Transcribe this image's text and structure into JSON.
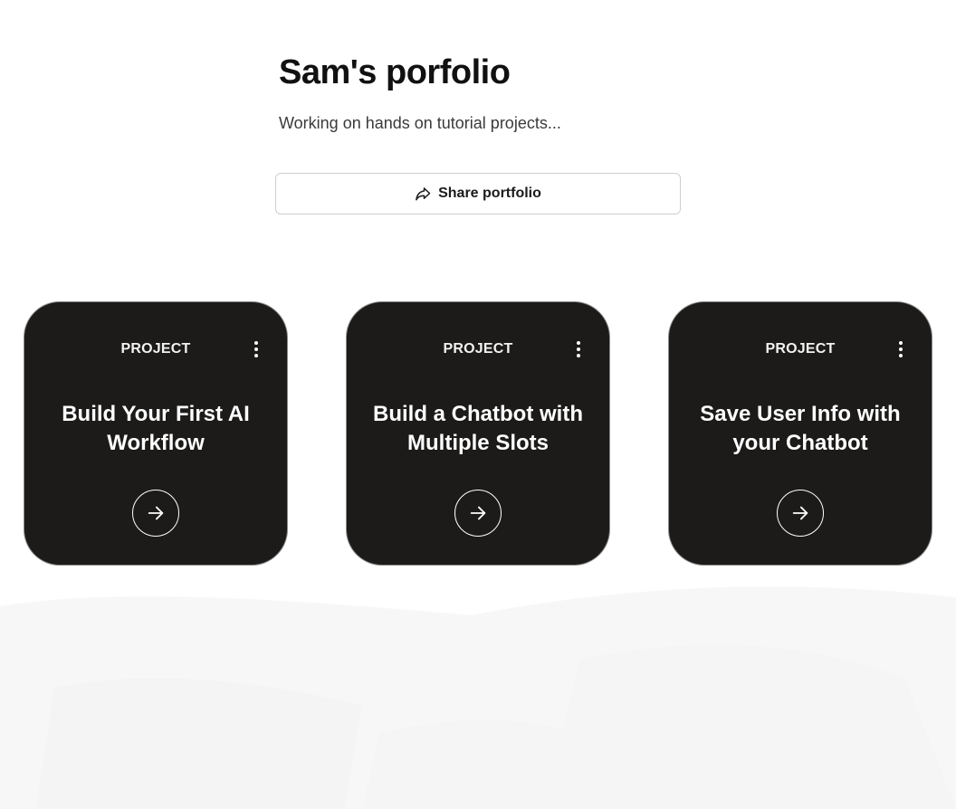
{
  "header": {
    "title": "Sam's porfolio",
    "subtitle": "Working on hands on tutorial projects..."
  },
  "share": {
    "label": "Share portfolio",
    "icon": "share-arrow-icon"
  },
  "cards": [
    {
      "kind": "PROJECT",
      "title": "Build Your First AI Workflow",
      "menu_icon": "more-vertical-icon",
      "action_icon": "arrow-right-circle-icon"
    },
    {
      "kind": "PROJECT",
      "title": "Build a Chatbot with Multiple Slots",
      "menu_icon": "more-vertical-icon",
      "action_icon": "arrow-right-circle-icon"
    },
    {
      "kind": "PROJECT",
      "title": "Save User Info with your Chatbot",
      "menu_icon": "more-vertical-icon",
      "action_icon": "arrow-right-circle-icon"
    }
  ],
  "colors": {
    "card_background": "#1c1b1a",
    "page_background": "#ffffff",
    "text_primary": "#111111"
  }
}
